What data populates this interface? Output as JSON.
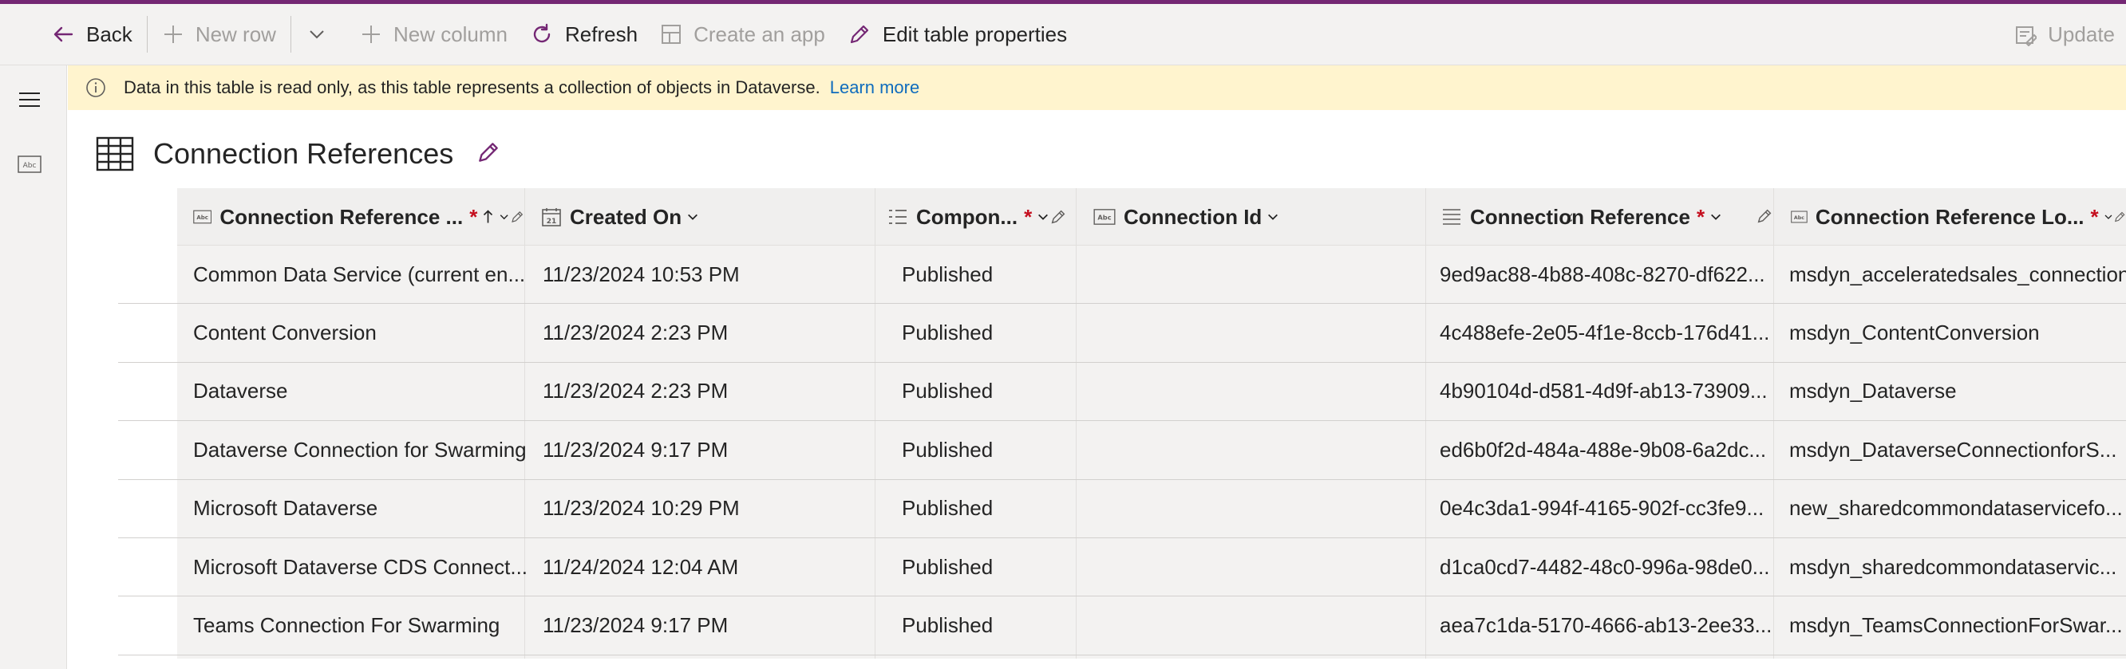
{
  "commandbar": {
    "back": "Back",
    "new_row": "New row",
    "new_column": "New column",
    "refresh": "Refresh",
    "create_app": "Create an app",
    "edit_table_properties": "Edit table properties",
    "update": "Update"
  },
  "infobar": {
    "message": "Data in this table is read only, as this table represents a collection of objects in Dataverse.",
    "link": "Learn more"
  },
  "table": {
    "title": "Connection References",
    "columns": [
      {
        "label": "Connection Reference ...",
        "required": "*"
      },
      {
        "label": "Created On"
      },
      {
        "label": "Compon...",
        "required": "*"
      },
      {
        "label": "Connection Id"
      },
      {
        "label": "Connection Reference",
        "required": "*"
      },
      {
        "label": "Connection Reference Lo...",
        "required": "*"
      }
    ],
    "rows": [
      [
        "Common Data Service (current en...",
        "11/23/2024 10:53 PM",
        "Published",
        "",
        "9ed9ac88-4b88-408c-8270-df622...",
        "msdyn_acceleratedsales_connection"
      ],
      [
        "Content Conversion",
        "11/23/2024 2:23 PM",
        "Published",
        "",
        "4c488efe-2e05-4f1e-8ccb-176d41...",
        "msdyn_ContentConversion"
      ],
      [
        "Dataverse",
        "11/23/2024 2:23 PM",
        "Published",
        "",
        "4b90104d-d581-4d9f-ab13-73909...",
        "msdyn_Dataverse"
      ],
      [
        "Dataverse Connection for Swarming",
        "11/23/2024 9:17 PM",
        "Published",
        "",
        "ed6b0f2d-484a-488e-9b08-6a2dc...",
        "msdyn_DataverseConnectionforS..."
      ],
      [
        "Microsoft Dataverse",
        "11/23/2024 10:29 PM",
        "Published",
        "",
        "0e4c3da1-994f-4165-902f-cc3fe9...",
        "new_sharedcommondataservicefo..."
      ],
      [
        "Microsoft Dataverse CDS Connect...",
        "11/24/2024 12:04 AM",
        "Published",
        "",
        "d1ca0cd7-4482-48c0-996a-98de0...",
        "msdyn_sharedcommondataservic..."
      ],
      [
        "Teams Connection For Swarming",
        "11/23/2024 9:17 PM",
        "Published",
        "",
        "aea7c1da-5170-4666-ab13-2ee33...",
        "msdyn_TeamsConnectionForSwar..."
      ]
    ]
  },
  "colors": {
    "accent": "#742774",
    "info_bg": "#fff4ce",
    "link": "#0f6cbd",
    "required": "#c50f1f"
  },
  "icons": [
    "back-arrow-icon",
    "plus-icon",
    "chevron-down-icon",
    "refresh-icon",
    "create-app-icon",
    "pencil-icon",
    "update-icon",
    "hamburger-icon",
    "text-field-icon",
    "info-icon",
    "table-icon",
    "calendar-icon",
    "choice-list-icon",
    "sort-up-icon"
  ]
}
